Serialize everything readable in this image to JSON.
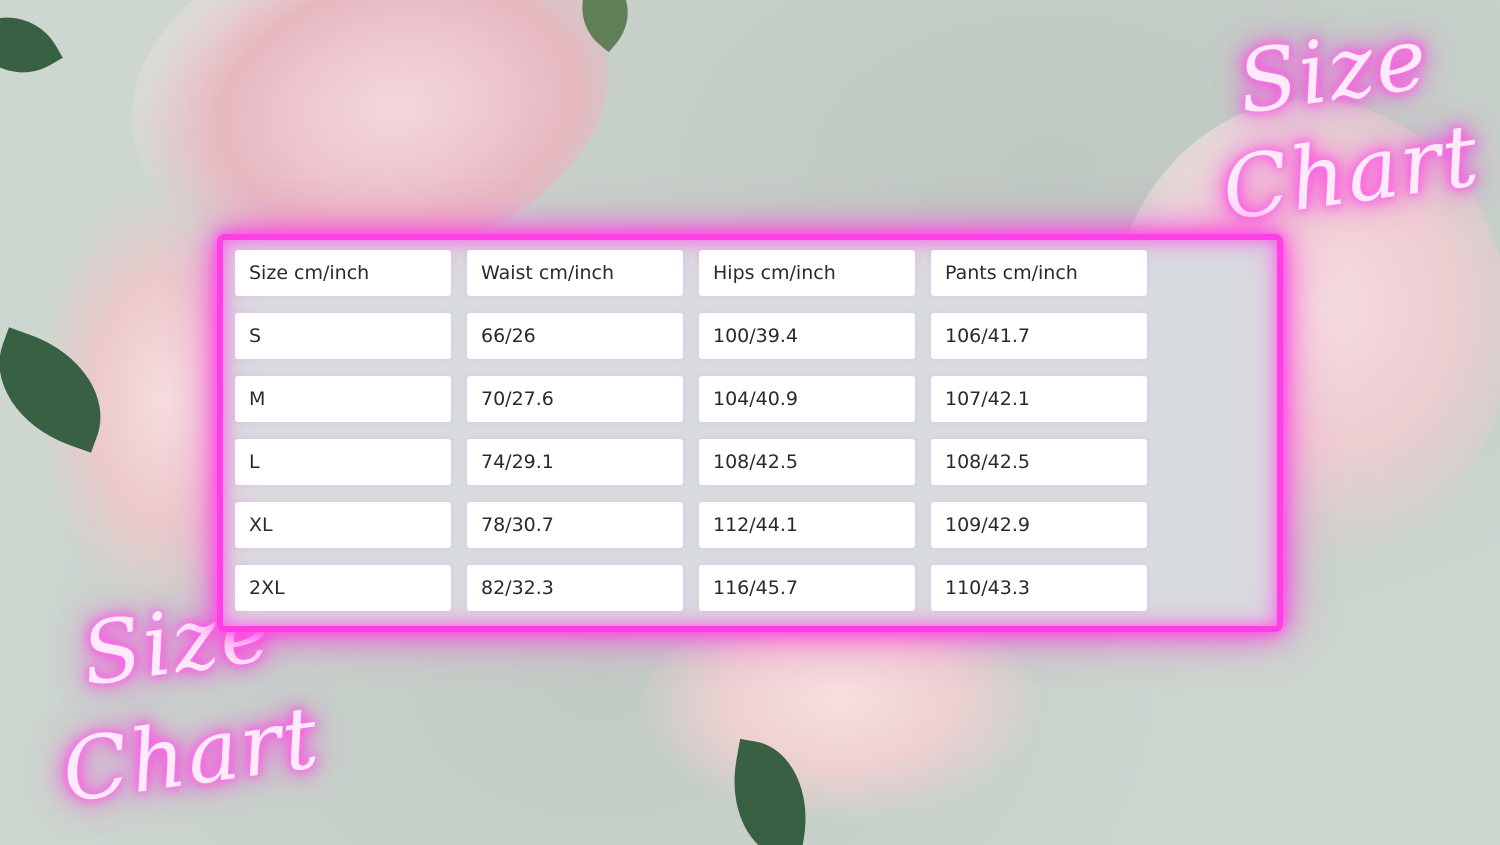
{
  "sign": {
    "top_right": {
      "line1": "Size",
      "line2": "Chart"
    },
    "bottom_left": {
      "line1": "Size",
      "line2": "Chart"
    }
  },
  "table": {
    "headers": [
      "Size cm/inch",
      "Waist cm/inch",
      "Hips cm/inch",
      "Pants cm/inch"
    ],
    "rows": [
      [
        "S",
        "66/26",
        "100/39.4",
        "106/41.7"
      ],
      [
        "M",
        "70/27.6",
        "104/40.9",
        "107/42.1"
      ],
      [
        "L",
        "74/29.1",
        "108/42.5",
        "108/42.5"
      ],
      [
        "XL",
        "78/30.7",
        "112/44.1",
        "109/42.9"
      ],
      [
        "2XL",
        "82/32.3",
        "116/45.7",
        "110/43.3"
      ]
    ]
  },
  "colors": {
    "neon_pink": "#ff3fe6",
    "panel_background": "#d9dcdf",
    "cell_background": "#ffffff",
    "page_background": "#cdd6cf"
  }
}
